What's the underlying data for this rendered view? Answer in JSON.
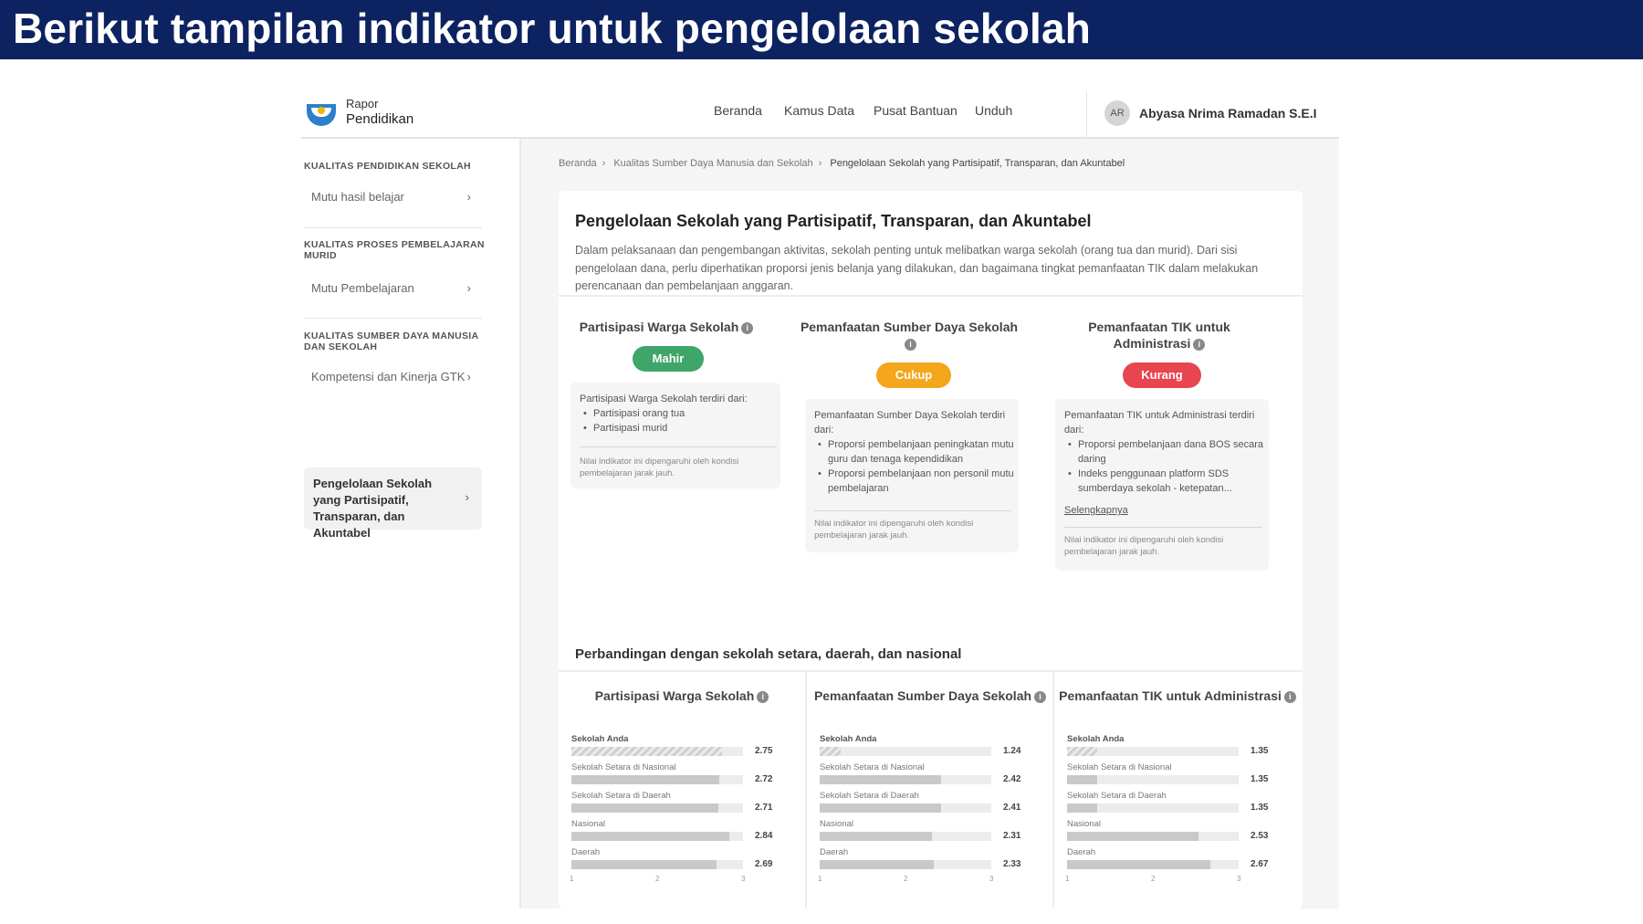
{
  "banner": {
    "title": "Berikut tampilan indikator untuk pengelolaan sekolah"
  },
  "colors": {
    "banner_bg": "#0d2260",
    "mahir": "#3fa56a",
    "cukup": "#f4a61c",
    "kurang": "#e8454f"
  },
  "topnav": {
    "logo_line1": "Rapor",
    "logo_line2": "Pendidikan",
    "links": [
      "Beranda",
      "Kamus Data",
      "Pusat Bantuan",
      "Unduh"
    ],
    "avatar_initials": "AR",
    "user_name": "Abyasa Nrima Ramadan S.E.I"
  },
  "sidebar": {
    "sections": [
      {
        "title": "KUALITAS PENDIDIKAN SEKOLAH",
        "item": "Mutu hasil belajar"
      },
      {
        "title": "KUALITAS PROSES PEMBELAJARAN MURID",
        "item": "Mutu Pembelajaran"
      },
      {
        "title": "KUALITAS SUMBER DAYA MANUSIA DAN SEKOLAH",
        "item": "Kompetensi dan Kinerja GTK"
      }
    ],
    "active_item": "Pengelolaan Sekolah yang Partisipatif, Transparan, dan Akuntabel",
    "chevron": "chevron-right-icon"
  },
  "breadcrumb": [
    "Beranda",
    "Kualitas Sumber Daya Manusia dan Sekolah",
    "Pengelolaan Sekolah yang Partisipatif, Transparan, dan Akuntabel"
  ],
  "card": {
    "title": "Pengelolaan Sekolah yang Partisipatif, Transparan, dan Akuntabel",
    "description": "Dalam pelaksanaan dan pengembangan aktivitas, sekolah penting untuk melibatkan warga sekolah (orang tua dan murid). Dari sisi pengelolaan dana, perlu diperhatikan proporsi jenis belanja yang dilakukan, dan bagaimana tingkat pemanfaatan TIK dalam melakukan perencanaan dan pembelanjaan anggaran."
  },
  "indicators": [
    {
      "title": "Partisipasi Warga Sekolah",
      "status": "Mahir",
      "intro": "Partisipasi Warga Sekolah terdiri dari:",
      "items": [
        "Partisipasi orang tua",
        "Partisipasi murid"
      ],
      "more": "",
      "note": "Nilai indikator ini dipengaruhi oleh kondisi pembelajaran jarak jauh."
    },
    {
      "title": "Pemanfaatan Sumber Daya Sekolah",
      "status": "Cukup",
      "intro": "Pemanfaatan Sumber Daya Sekolah terdiri dari:",
      "items": [
        "Proporsi pembelanjaan peningkatan mutu guru dan tenaga kependidikan",
        "Proporsi pembelanjaan non personil mutu pembelajaran"
      ],
      "more": "",
      "note": "Nilai indikator ini dipengaruhi oleh kondisi pembelajaran jarak jauh."
    },
    {
      "title": "Pemanfaatan TIK untuk Administrasi",
      "status": "Kurang",
      "intro": "Pemanfaatan TIK untuk Administrasi terdiri dari:",
      "items": [
        "Proporsi pembelanjaan dana BOS secara daring",
        "Indeks penggunaan platform SDS sumberdaya sekolah - ketepatan..."
      ],
      "more": "Selengkapnya",
      "note": "Nilai indikator ini dipengaruhi oleh kondisi pembelajaran jarak jauh."
    }
  ],
  "comparison": {
    "title": "Perbandingan dengan sekolah setara, daerah, dan nasional",
    "row_labels": [
      "Sekolah Anda",
      "Sekolah Setara di Nasional",
      "Sekolah Setara di Daerah",
      "Nasional",
      "Daerah"
    ],
    "ticks": [
      "1",
      "2",
      "3"
    ]
  },
  "chart_data": [
    {
      "type": "bar",
      "title": "Partisipasi Warga Sekolah",
      "categories": [
        "Sekolah Anda",
        "Sekolah Setara di Nasional",
        "Sekolah Setara di Daerah",
        "Nasional",
        "Daerah"
      ],
      "values": [
        2.75,
        2.72,
        2.71,
        2.84,
        2.69
      ],
      "value_labels": [
        "2.75",
        "2.72",
        "2.71",
        "2.84",
        "2.69"
      ],
      "xlim": [
        1,
        3
      ]
    },
    {
      "type": "bar",
      "title": "Pemanfaatan Sumber Daya Sekolah",
      "categories": [
        "Sekolah Anda",
        "Sekolah Setara di Nasional",
        "Sekolah Setara di Daerah",
        "Nasional",
        "Daerah"
      ],
      "values": [
        1.24,
        2.42,
        2.41,
        2.31,
        2.33
      ],
      "value_labels": [
        "1.24",
        "2.42",
        "2.41",
        "2.31",
        "2.33"
      ],
      "xlim": [
        1,
        3
      ]
    },
    {
      "type": "bar",
      "title": "Pemanfaatan TIK untuk Administrasi",
      "categories": [
        "Sekolah Anda",
        "Sekolah Setara di Nasional",
        "Sekolah Setara di Daerah",
        "Nasional",
        "Daerah"
      ],
      "values": [
        1.35,
        1.35,
        1.35,
        2.53,
        2.67
      ],
      "value_labels": [
        "1.35",
        "1.35",
        "1.35",
        "2.53",
        "2.67"
      ],
      "xlim": [
        1,
        3
      ]
    }
  ]
}
